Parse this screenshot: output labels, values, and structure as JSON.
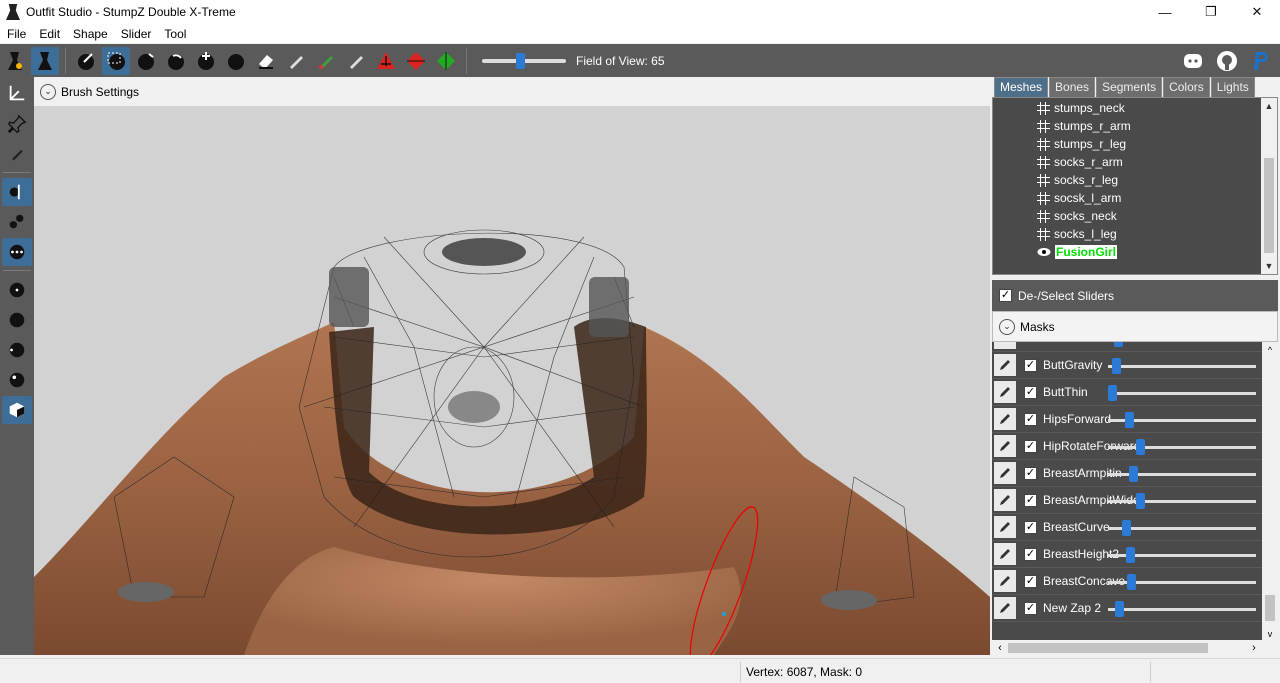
{
  "window": {
    "title": "Outfit Studio - StumpZ Double X-Treme",
    "minimize": "—",
    "maximize": "❐",
    "close": "✕"
  },
  "menu": [
    "File",
    "Edit",
    "Shape",
    "Slider",
    "Tool"
  ],
  "toolbar": {
    "fov_label": "Field of View: 65",
    "fov_value": 65
  },
  "brush": {
    "label": "Brush Settings"
  },
  "tabs": [
    "Meshes",
    "Bones",
    "Segments",
    "Colors",
    "Lights"
  ],
  "meshes": [
    "stumps_neck",
    "stumps_r_arm",
    "stumps_r_leg",
    "socks_r_arm",
    "socks_r_leg",
    "socsk_l_arm",
    "socks_neck",
    "socks_l_leg",
    "FusionGirl"
  ],
  "deselect_label": "De-/Select Sliders",
  "masks_label": "Masks",
  "sliders": [
    {
      "name": "ButtGravity",
      "value": 0.03
    },
    {
      "name": "ButtThin",
      "value": 0.0
    },
    {
      "name": "HipsForward",
      "value": 0.12
    },
    {
      "name": "HipRotateForward",
      "value": 0.2
    },
    {
      "name": "BreastArmpitin",
      "value": 0.15
    },
    {
      "name": "BreastArmpitWide",
      "value": 0.2
    },
    {
      "name": "BreastCurve",
      "value": 0.1
    },
    {
      "name": "BreastHeight2",
      "value": 0.13
    },
    {
      "name": "BreastConcave",
      "value": 0.14
    },
    {
      "name": "New Zap 2",
      "value": 0.05
    }
  ],
  "status": {
    "vertex": "Vertex: 6087, Mask: 0"
  },
  "colors": {
    "accent": "#2a7ad6",
    "toolbar": "#5a5a5a",
    "selected_mesh": "#00e000"
  }
}
